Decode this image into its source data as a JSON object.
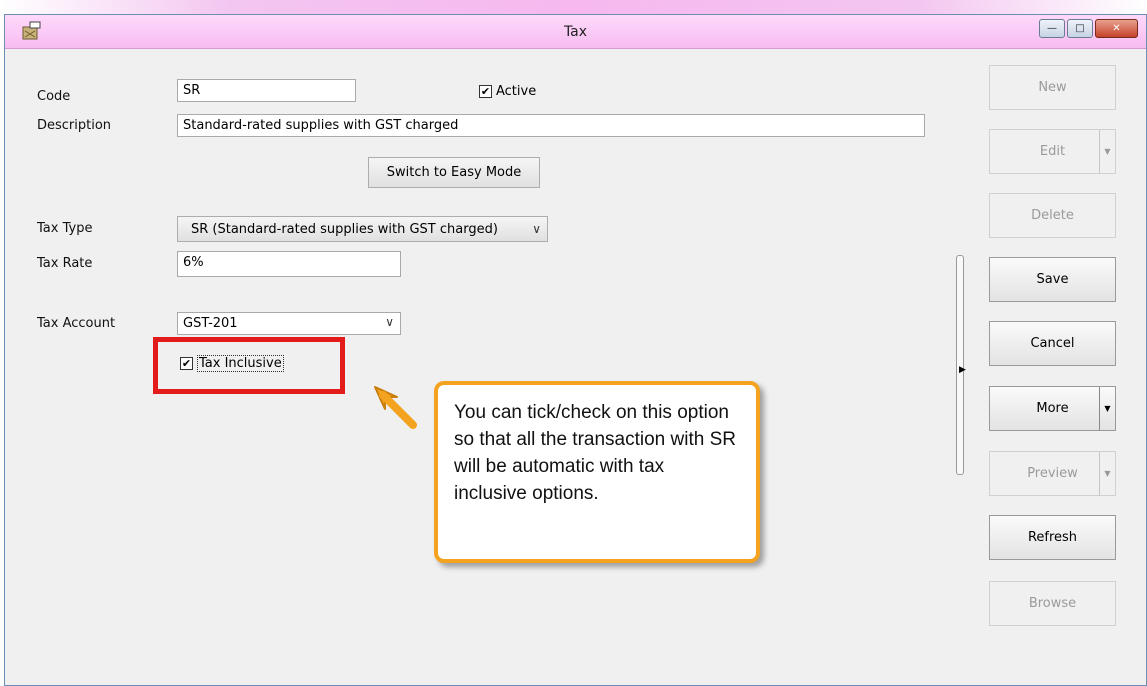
{
  "window": {
    "title": "Tax"
  },
  "form": {
    "code_label": "Code",
    "code_value": "SR",
    "active_label": "Active",
    "description_label": "Description",
    "description_value": "Standard-rated supplies with GST charged",
    "switch_mode_label": "Switch to Easy Mode",
    "tax_type_label": "Tax Type",
    "tax_type_value": "SR (Standard-rated supplies with GST charged)",
    "tax_rate_label": "Tax Rate",
    "tax_rate_value": "6%",
    "tax_account_label": "Tax Account",
    "tax_account_value": "GST-201",
    "tax_inclusive_label": "Tax Inclusive"
  },
  "side_buttons": {
    "new": "New",
    "edit": "Edit",
    "delete": "Delete",
    "save": "Save",
    "cancel": "Cancel",
    "more": "More",
    "preview": "Preview",
    "refresh": "Refresh",
    "browse": "Browse"
  },
  "callout": {
    "text": "You can tick/check on this option so that all the transaction with SR will be automatic with tax inclusive options."
  },
  "colors": {
    "titlebar": "#f6bdf1",
    "highlight_border": "#e31b1b",
    "callout_border": "#f3a31f"
  }
}
